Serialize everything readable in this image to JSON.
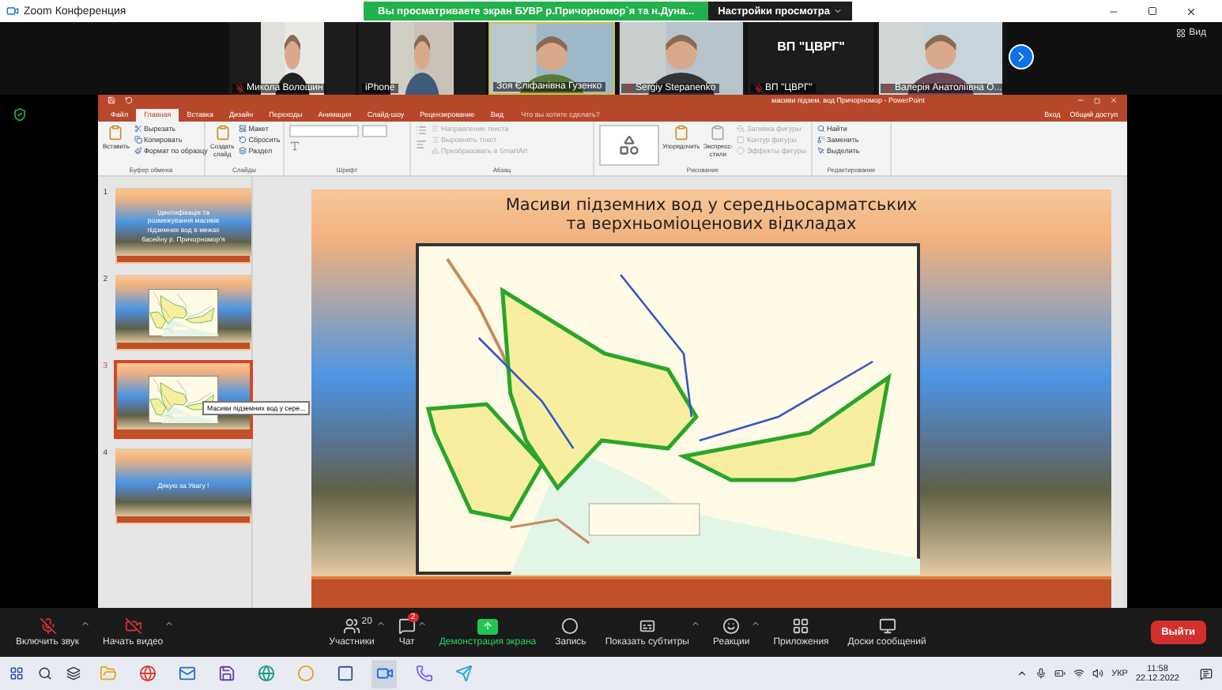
{
  "window": {
    "title": "Zoom Конференция"
  },
  "share_banner": {
    "text": "Вы просматриваете экран БУВР р.Причорномор`я та н.Дуна...",
    "settings": "Настройки просмотра"
  },
  "view_button": "Вид",
  "participants": [
    {
      "name": "Микола Волошин",
      "muted": true,
      "active": false,
      "kind": "video"
    },
    {
      "name": "iPhone",
      "muted": false,
      "active": false,
      "kind": "video"
    },
    {
      "name": "Зоя Єліфанівна Гузенко",
      "muted": false,
      "active": true,
      "kind": "video"
    },
    {
      "name": "Sergiy Stepanenko",
      "muted": true,
      "active": false,
      "kind": "video"
    },
    {
      "name": "ВП \"ЦВРГ\"",
      "muted": true,
      "active": false,
      "kind": "text",
      "tile_text": "ВП \"ЦВРГ\""
    },
    {
      "name": "Валерія Анатоліївна О...",
      "muted": true,
      "active": false,
      "kind": "video"
    }
  ],
  "powerpoint": {
    "title": "масиви підзем. вод Причорномор - PowerPoint",
    "tabs": [
      {
        "label": "Файл",
        "selected": false
      },
      {
        "label": "Главная",
        "selected": true
      },
      {
        "label": "Вставка",
        "selected": false
      },
      {
        "label": "Дизайн",
        "selected": false
      },
      {
        "label": "Переходы",
        "selected": false
      },
      {
        "label": "Анимация",
        "selected": false
      },
      {
        "label": "Слайд-шоу",
        "selected": false
      },
      {
        "label": "Рецензирование",
        "selected": false
      },
      {
        "label": "Вид",
        "selected": false
      }
    ],
    "tell_me": "Что вы хотите сделать?",
    "sign_in": "Вход",
    "share": "Общий доступ",
    "ribbon_groups": [
      {
        "label": "Буфер обмена",
        "large": [
          "Вставить"
        ],
        "items": [
          {
            "label": "Вырезать",
            "disabled": false
          },
          {
            "label": "Копировать",
            "disabled": false
          },
          {
            "label": "Формат по образцу",
            "disabled": false
          }
        ]
      },
      {
        "label": "Слайды",
        "large": [
          "Создать слайд"
        ],
        "items": [
          {
            "label": "Макет",
            "disabled": false
          },
          {
            "label": "Сбросить",
            "disabled": false
          },
          {
            "label": "Раздел",
            "disabled": false
          }
        ]
      },
      {
        "label": "Шрифт",
        "kind": "font"
      },
      {
        "label": "Абзац",
        "kind": "paragraph",
        "items": [
          {
            "label": "Направление текста",
            "disabled": true
          },
          {
            "label": "Выровнять текст",
            "disabled": true
          },
          {
            "label": "Преобразовать в SmartArt",
            "disabled": true
          }
        ]
      },
      {
        "label": "Рисование",
        "kind": "drawing",
        "large": [
          "Упорядочить",
          "Экспресс-стили"
        ],
        "items": [
          {
            "label": "Заливка фигуры",
            "disabled": true
          },
          {
            "label": "Контур фигуры",
            "disabled": true
          },
          {
            "label": "Эффекты фигуры",
            "disabled": true
          }
        ]
      },
      {
        "label": "Редактирование",
        "items": [
          {
            "label": "Найти",
            "disabled": false
          },
          {
            "label": "Заменить",
            "disabled": false
          },
          {
            "label": "Выделить",
            "disabled": false
          }
        ]
      }
    ],
    "thumbnails": [
      {
        "number": "1",
        "selected": false,
        "kind": "text",
        "text": "Ідентифікація та розмежування масивів підземних вод в межах басейну р. Причорномор'я"
      },
      {
        "number": "2",
        "selected": false,
        "kind": "picture"
      },
      {
        "number": "3",
        "selected": true,
        "kind": "picture"
      },
      {
        "number": "4",
        "selected": false,
        "kind": "text",
        "text": "Дякую за Увагу !"
      }
    ],
    "tooltip": "Масиви підземних вод у сере...",
    "slide": {
      "title_lines": [
        "Масиви підземних вод у середньосарматських",
        "та верхньоміоценових відкладах"
      ]
    }
  },
  "toolbar": [
    {
      "label": "Включить звук",
      "kind": "mic",
      "caret": true,
      "highlight": false
    },
    {
      "label": "Начать видео",
      "kind": "video",
      "caret": true,
      "highlight": false
    },
    {
      "label": "Участники",
      "kind": "participants",
      "caret": true,
      "highlight": false,
      "count": "20"
    },
    {
      "label": "Чат",
      "kind": "chat",
      "caret": true,
      "highlight": false,
      "badge": "2"
    },
    {
      "label": "Демонстрация экрана",
      "kind": "share",
      "caret": false,
      "highlight": true
    },
    {
      "label": "Запись",
      "kind": "record",
      "caret": false,
      "highlight": false
    },
    {
      "label": "Показать субтитры",
      "kind": "captions",
      "caret": true,
      "highlight": false
    },
    {
      "label": "Реакции",
      "kind": "reactions",
      "caret": true,
      "highlight": false
    },
    {
      "label": "Приложения",
      "kind": "apps",
      "caret": false,
      "highlight": false
    },
    {
      "label": "Доски сообщений",
      "kind": "board",
      "caret": false,
      "highlight": false
    }
  ],
  "leave_button": "Выйти",
  "taskbar": {
    "language": "УКР",
    "time": "11:58",
    "date": "22.12.2022"
  }
}
